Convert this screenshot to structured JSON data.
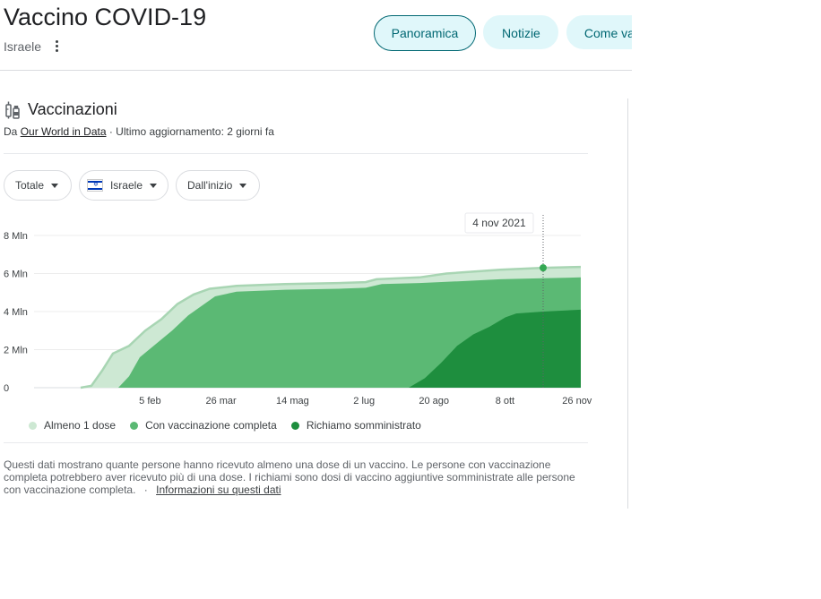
{
  "header": {
    "title": "Vaccino COVID-19",
    "location": "Israele",
    "tabs": [
      "Panoramica",
      "Notizie",
      "Come va"
    ]
  },
  "card": {
    "title": "Vaccinazioni",
    "source_prefix": "Da",
    "source_name": "Our World in Data",
    "updated": "· Ultimo aggiornamento: 2 giorni fa",
    "filters": {
      "metric": "Totale",
      "country": "Israele",
      "period": "Dall'inizio"
    },
    "tooltip_date": "4 nov 2021",
    "description": "Questi dati mostrano quante persone hanno ricevuto almeno una dose di un vaccino. Le persone con vaccinazione completa potrebbero aver ricevuto più di una dose. I richiami sono dosi di vaccino aggiuntive somministrate alle persone con vaccinazione completa.",
    "info_sep": "·",
    "info_link": "Informazioni su questi dati"
  },
  "chart_data": {
    "type": "area",
    "y_ticks": [
      "0",
      "2 Mln",
      "4 Mln",
      "6 Mln",
      "8 Mln"
    ],
    "ylim": [
      0,
      8
    ],
    "x_ticks": [
      "5 feb",
      "26 mar",
      "14 mag",
      "2 lug",
      "20 ago",
      "8 ott",
      "26 nov"
    ],
    "x_tick_pos": [
      0.199,
      0.331,
      0.464,
      0.597,
      0.727,
      0.859,
      0.993
    ],
    "tooltip_x": 0.93,
    "tooltip_value": 6.3,
    "series": [
      {
        "name": "Almeno 1 dose",
        "color": "#cde8d3",
        "points": [
          [
            0.07,
            0
          ],
          [
            0.09,
            0.1
          ],
          [
            0.11,
            0.9
          ],
          [
            0.13,
            1.8
          ],
          [
            0.16,
            2.2
          ],
          [
            0.19,
            3.0
          ],
          [
            0.22,
            3.6
          ],
          [
            0.25,
            4.4
          ],
          [
            0.28,
            4.9
          ],
          [
            0.31,
            5.2
          ],
          [
            0.36,
            5.35
          ],
          [
            0.45,
            5.45
          ],
          [
            0.55,
            5.5
          ],
          [
            0.6,
            5.55
          ],
          [
            0.62,
            5.7
          ],
          [
            0.7,
            5.8
          ],
          [
            0.75,
            6.0
          ],
          [
            0.85,
            6.2
          ],
          [
            0.93,
            6.3
          ],
          [
            1.0,
            6.35
          ]
        ]
      },
      {
        "name": "Con vaccinazione completa",
        "color": "#5bb974",
        "points": [
          [
            0.14,
            0
          ],
          [
            0.16,
            0.6
          ],
          [
            0.18,
            1.6
          ],
          [
            0.21,
            2.3
          ],
          [
            0.24,
            3.0
          ],
          [
            0.27,
            3.8
          ],
          [
            0.3,
            4.4
          ],
          [
            0.32,
            4.8
          ],
          [
            0.36,
            5.05
          ],
          [
            0.45,
            5.15
          ],
          [
            0.55,
            5.2
          ],
          [
            0.6,
            5.25
          ],
          [
            0.63,
            5.45
          ],
          [
            0.7,
            5.5
          ],
          [
            0.78,
            5.6
          ],
          [
            0.85,
            5.7
          ],
          [
            0.93,
            5.75
          ],
          [
            1.0,
            5.8
          ]
        ]
      },
      {
        "name": "Richiamo somministrato",
        "color": "#1e8e3e",
        "points": [
          [
            0.68,
            0
          ],
          [
            0.71,
            0.5
          ],
          [
            0.74,
            1.3
          ],
          [
            0.77,
            2.2
          ],
          [
            0.8,
            2.8
          ],
          [
            0.83,
            3.2
          ],
          [
            0.86,
            3.7
          ],
          [
            0.88,
            3.9
          ],
          [
            0.93,
            4.0
          ],
          [
            1.0,
            4.1
          ]
        ]
      }
    ]
  }
}
